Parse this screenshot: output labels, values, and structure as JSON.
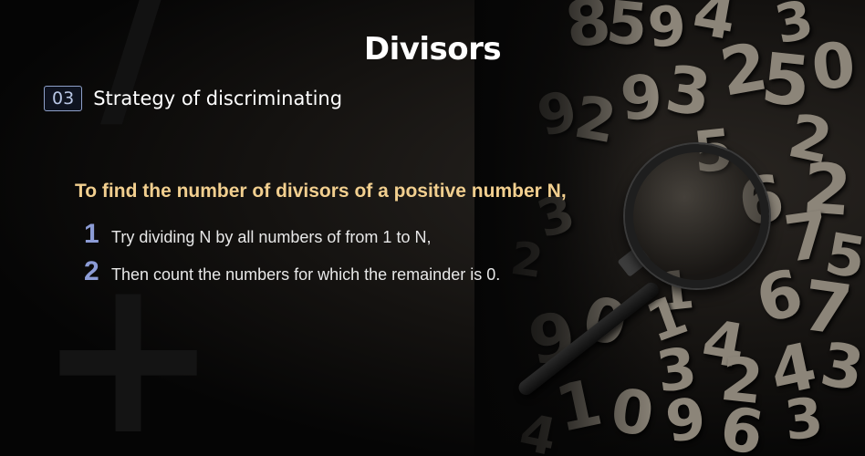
{
  "slide": {
    "title": "Divisors",
    "section_number": "03",
    "section_label": "Strategy of discriminating",
    "lead": "To find the number of divisors of a positive number N,",
    "steps": [
      {
        "number": "1",
        "text": "Try dividing N by all numbers of from 1 to N,"
      },
      {
        "number": "2",
        "text": "Then count the numbers for which the remainder is 0."
      }
    ]
  },
  "colors": {
    "background": "#050505",
    "title": "#ffffff",
    "lead": "#f2cf8f",
    "step_number": "#8c9cd6",
    "section_border": "#8ea0c9"
  },
  "decor": {
    "digits": [
      "8",
      "5",
      "9",
      "4",
      "3",
      "2",
      "5",
      "0",
      "9",
      "2",
      "9",
      "3",
      "5",
      "2",
      "6",
      "2",
      "7",
      "5",
      "3",
      "2",
      "1",
      "6",
      "7",
      "9",
      "0",
      "1",
      "4",
      "3",
      "2",
      "4",
      "3",
      "1",
      "0",
      "9",
      "6",
      "3",
      "4"
    ],
    "icons": [
      "magnifier-icon",
      "plus-glyph"
    ]
  }
}
